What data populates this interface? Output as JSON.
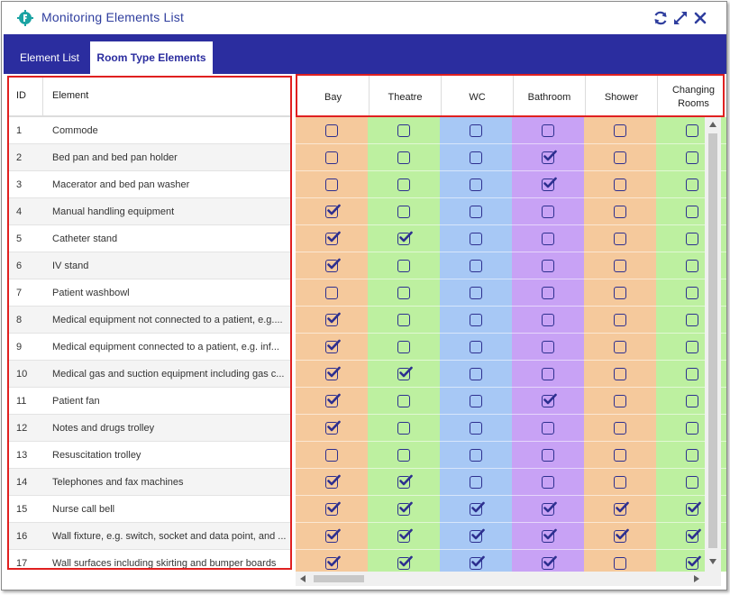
{
  "window": {
    "title": "Monitoring Elements List",
    "icon": "gear-icon"
  },
  "toolbar": {
    "refresh_icon": "refresh-icon",
    "expand_icon": "expand-icon",
    "close_icon": "close-icon"
  },
  "tabs": [
    {
      "label": "Element List",
      "active": false
    },
    {
      "label": "Room Type Elements",
      "active": true
    }
  ],
  "left_table": {
    "headers": {
      "id": "ID",
      "element": "Element"
    },
    "rows": [
      {
        "id": "1",
        "element": "Commode"
      },
      {
        "id": "2",
        "element": "Bed pan and bed pan holder"
      },
      {
        "id": "3",
        "element": "Macerator and bed pan washer"
      },
      {
        "id": "4",
        "element": "Manual handling equipment"
      },
      {
        "id": "5",
        "element": "Catheter stand"
      },
      {
        "id": "6",
        "element": "IV stand"
      },
      {
        "id": "7",
        "element": "Patient washbowl"
      },
      {
        "id": "8",
        "element": "Medical equipment not connected to a patient, e.g...."
      },
      {
        "id": "9",
        "element": "Medical equipment connected to a patient, e.g. inf..."
      },
      {
        "id": "10",
        "element": "Medical gas and suction equipment including gas c..."
      },
      {
        "id": "11",
        "element": "Patient fan"
      },
      {
        "id": "12",
        "element": "Notes and drugs trolley"
      },
      {
        "id": "13",
        "element": "Resuscitation trolley"
      },
      {
        "id": "14",
        "element": "Telephones and fax machines"
      },
      {
        "id": "15",
        "element": "Nurse call bell"
      },
      {
        "id": "16",
        "element": "Wall fixture, e.g. switch, socket and data point, and ..."
      },
      {
        "id": "17",
        "element": "Wall surfaces including skirting and bumper boards"
      }
    ]
  },
  "room_types": [
    {
      "label": "Bay",
      "color": "#f5c99c"
    },
    {
      "label": "Theatre",
      "color": "#bdf0a0"
    },
    {
      "label": "WC",
      "color": "#a7c8f5"
    },
    {
      "label": "Bathroom",
      "color": "#c8a2f5"
    },
    {
      "label": "Shower",
      "color": "#f5c99c"
    },
    {
      "label": "Changing Rooms",
      "color": "#bdf0a0"
    }
  ],
  "checks": [
    [
      false,
      false,
      false,
      false,
      false,
      false
    ],
    [
      false,
      false,
      false,
      true,
      false,
      false
    ],
    [
      false,
      false,
      false,
      true,
      false,
      false
    ],
    [
      true,
      false,
      false,
      false,
      false,
      false
    ],
    [
      true,
      true,
      false,
      false,
      false,
      false
    ],
    [
      true,
      false,
      false,
      false,
      false,
      false
    ],
    [
      false,
      false,
      false,
      false,
      false,
      false
    ],
    [
      true,
      false,
      false,
      false,
      false,
      false
    ],
    [
      true,
      false,
      false,
      false,
      false,
      false
    ],
    [
      true,
      true,
      false,
      false,
      false,
      false
    ],
    [
      true,
      false,
      false,
      true,
      false,
      false
    ],
    [
      true,
      false,
      false,
      false,
      false,
      false
    ],
    [
      false,
      false,
      false,
      false,
      false,
      false
    ],
    [
      true,
      true,
      false,
      false,
      false,
      false
    ],
    [
      true,
      true,
      true,
      true,
      true,
      true
    ],
    [
      true,
      true,
      true,
      true,
      true,
      true
    ],
    [
      true,
      true,
      true,
      true,
      false,
      true
    ]
  ]
}
